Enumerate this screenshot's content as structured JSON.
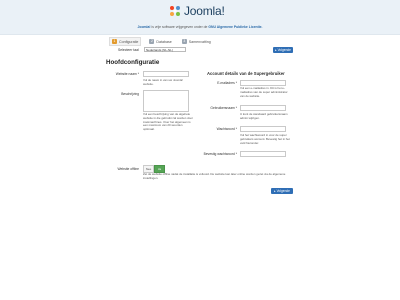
{
  "header": {
    "logo_text": "Joomla!",
    "tagline_brand": "Joomla!",
    "tagline_middle": " is vrije software vrijgegeven onder de ",
    "tagline_license": "GNU Algemene Publieke Licentie."
  },
  "steps": [
    {
      "number": "1",
      "label": "Configuratie"
    },
    {
      "number": "2",
      "label": "Database"
    },
    {
      "number": "3",
      "label": "Samenvatting"
    }
  ],
  "language": {
    "label": "Selecteer taal",
    "selected": "Nederlands (NL-NL)"
  },
  "buttons": {
    "next": "▸ Volgende"
  },
  "main_heading": "Hoofdconfiguratie",
  "site_name": {
    "label": "Website naam *",
    "value": "",
    "help": "Vul de naam in van uw Joomla! website."
  },
  "description": {
    "label": "Beschrijving",
    "value": "",
    "help": "Vul een beschrijving van de algehele website in die gebruikt zal worden door zoekmachines. Over het algemeen is een maximum van 20 woorden optimaal."
  },
  "admin_heading": "Account details van de Supergebruiker",
  "email": {
    "label": "E-mailadres *",
    "value": "",
    "help": "Vul een e-mailadres in. Dit is het e-mailadres van de super administrator van de website."
  },
  "username": {
    "label": "Gebruikersnaam *",
    "value": "",
    "help": "U kunt de standaard gebruikersnaam admin wijzigen."
  },
  "password": {
    "label": "Wachtwoord *",
    "value": "",
    "help": "Vul het wachtwoord in voor de super gebruikers account. Bevestig het in het veld hieronder."
  },
  "password_confirm": {
    "label": "Bevestig wachtwoord *",
    "value": ""
  },
  "offline": {
    "label": "Website offline",
    "no": "Nee",
    "yes": "Ja",
    "selected": "yes",
    "help": "Zet de website offline nadat de installatie is voltooid. De website kan later online worden gezet via de algemene instellingen."
  },
  "colors": {
    "primary_button": "#2f6eb5",
    "active_step": "#e29a2c",
    "toggle_on": "#56a556"
  }
}
